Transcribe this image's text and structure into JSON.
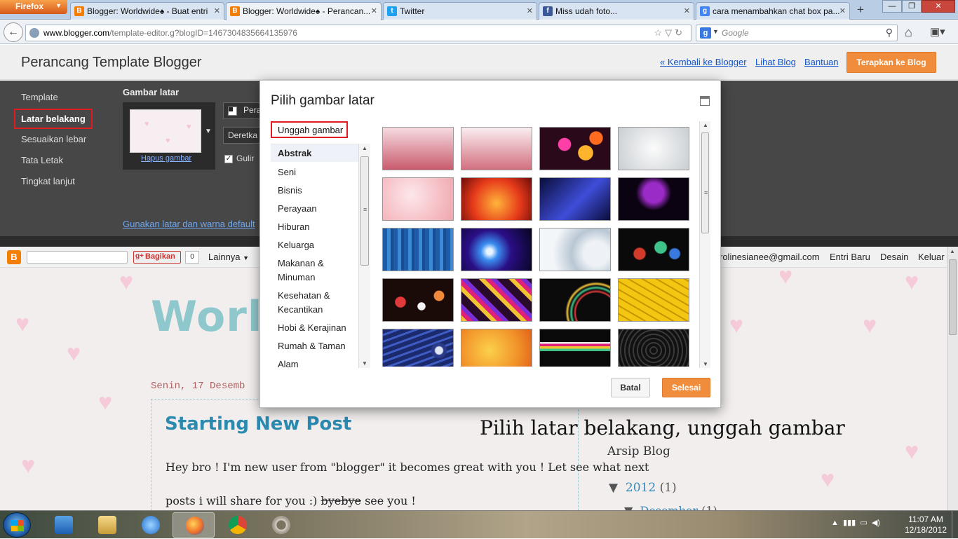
{
  "browser": {
    "app_button": "Firefox",
    "tabs": [
      {
        "label": "Blogger: Worldwide♠ - Buat entri",
        "icon": "blogger-icon",
        "color": "#f57d00",
        "active": false
      },
      {
        "label": "Blogger: Worldwide♠ - Perancan...",
        "icon": "blogger-icon",
        "color": "#f57d00",
        "active": true
      },
      {
        "label": "Twitter",
        "icon": "twitter-icon",
        "color": "#1da1f2",
        "active": false
      },
      {
        "label": "Miss udah foto...",
        "icon": "facebook-icon",
        "color": "#3b5998",
        "active": false
      },
      {
        "label": "cara menambahkan chat box pa...",
        "icon": "google-icon",
        "color": "#4285f4",
        "active": false
      }
    ],
    "url_domain": "www.blogger.com",
    "url_path": "/template-editor.g?blogID=1467304835664135976",
    "search_placeholder": "Google"
  },
  "app": {
    "title": "Perancang Template Blogger",
    "links": {
      "back": "« Kembali ke Blogger",
      "view": "Lihat Blog",
      "help": "Bantuan"
    },
    "apply_label": "Terapkan ke Blog",
    "accent": "#f08d3c"
  },
  "sidebar": {
    "items": [
      {
        "label": "Template"
      },
      {
        "label": "Latar belakang",
        "selected": true
      },
      {
        "label": "Sesuaikan lebar"
      },
      {
        "label": "Tata Letak"
      },
      {
        "label": "Tingkat lanjut"
      }
    ]
  },
  "background_panel": {
    "title": "Gambar latar",
    "remove_image": "Hapus gambar",
    "position_btn": "Pera",
    "repeat_btn": "Deretka",
    "scroll_label": "Gulir",
    "default_link": "Gunakan latar dan warna default"
  },
  "blog": {
    "nav": {
      "share": "Bagikan",
      "share_count": "0",
      "more": "Lainnya",
      "email": "rolinesianee@gmail.com",
      "new_post": "Entri Baru",
      "design": "Desain",
      "logout": "Keluar"
    },
    "title_partial": "Worl",
    "post_date": "Senin, 17 Desemb",
    "post_title": "Starting New Post",
    "post_body_1": "Hey bro ! I'm new user from \"blogger\" it becomes great with you ! Let see what next",
    "post_body_2a": "posts i will share for you :) ",
    "post_body_2b": "byebye",
    "post_body_2c": " see you !",
    "archive_title": "Arsip Blog",
    "archive_year": "2012",
    "archive_year_count": "(1)",
    "archive_month": "Desember",
    "archive_month_count": "(1)"
  },
  "caption": "Pilih latar belakang, unggah gambar",
  "dialog": {
    "title": "Pilih gambar latar",
    "upload": "Unggah gambar",
    "categories": [
      {
        "label": "Abstrak",
        "selected": true
      },
      {
        "label": "Seni"
      },
      {
        "label": "Bisnis"
      },
      {
        "label": "Perayaan"
      },
      {
        "label": "Hiburan"
      },
      {
        "label": "Keluarga"
      },
      {
        "label": "Makanan & Minuman"
      },
      {
        "label": "Kesehatan & Kecantikan"
      },
      {
        "label": "Hobi & Kerajinan"
      },
      {
        "label": "Rumah & Taman"
      },
      {
        "label": "Alam"
      }
    ],
    "cancel": "Batal",
    "done": "Selesai"
  },
  "taskbar": {
    "time": "11:07 AM",
    "date": "12/18/2012"
  }
}
